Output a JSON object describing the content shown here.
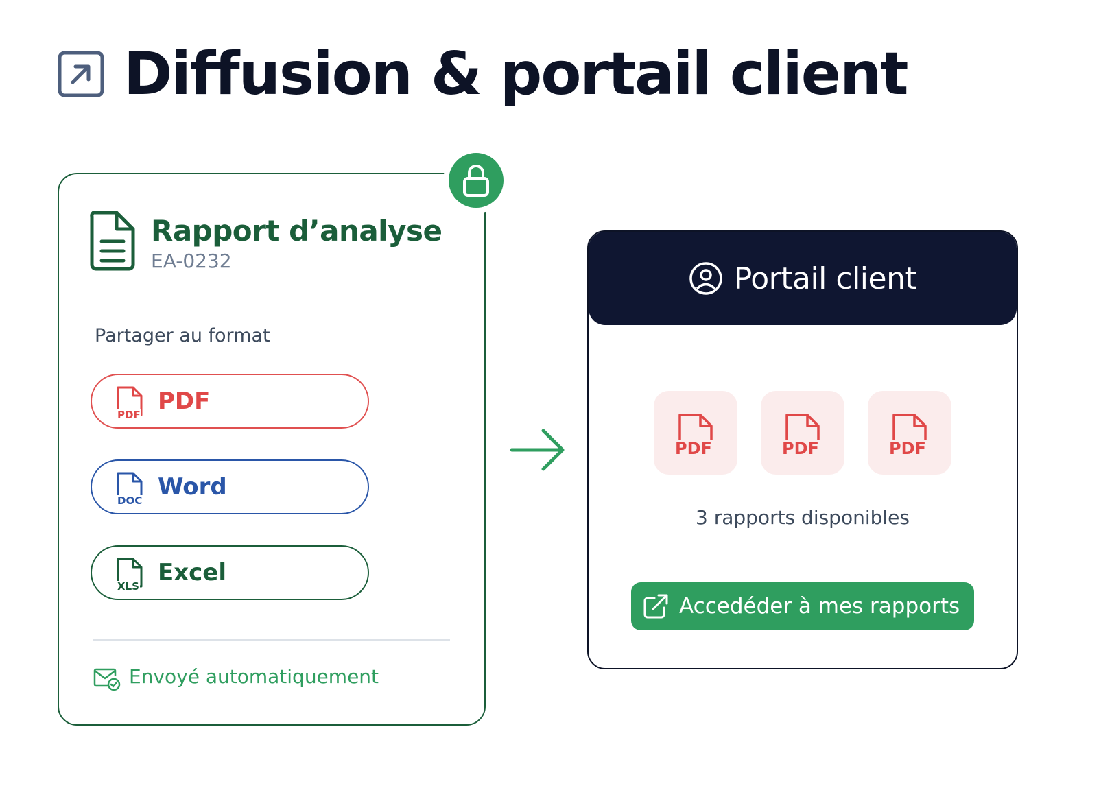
{
  "header": {
    "title": "Diffusion & portail client",
    "icon": "external-arrow-icon"
  },
  "report_card": {
    "title": "Rapport d’analyse",
    "id": "EA-0232",
    "share_label": "Partager au format",
    "formats": [
      {
        "label": "PDF",
        "tag": "PDF",
        "color": "#e04848",
        "icon": "pdf-file-icon"
      },
      {
        "label": "Word",
        "tag": "DOC",
        "color": "#2a56a8",
        "icon": "doc-file-icon"
      },
      {
        "label": "Excel",
        "tag": "XLS",
        "color": "#1b5e3a",
        "icon": "xls-file-icon"
      }
    ],
    "status": "Envoyé automatiquement",
    "lock_icon": "lock-icon"
  },
  "portal": {
    "title": "Portail client",
    "files": [
      {
        "tag": "PDF"
      },
      {
        "tag": "PDF"
      },
      {
        "tag": "PDF"
      }
    ],
    "count_label": "3 rapports disponibles",
    "cta_label": "Accedéder à mes rapports"
  },
  "colors": {
    "dark_navy": "#0f1631",
    "green": "#2f9e5f",
    "dark_green": "#1b5e3a",
    "red": "#e04848",
    "blue": "#2a56a8"
  }
}
